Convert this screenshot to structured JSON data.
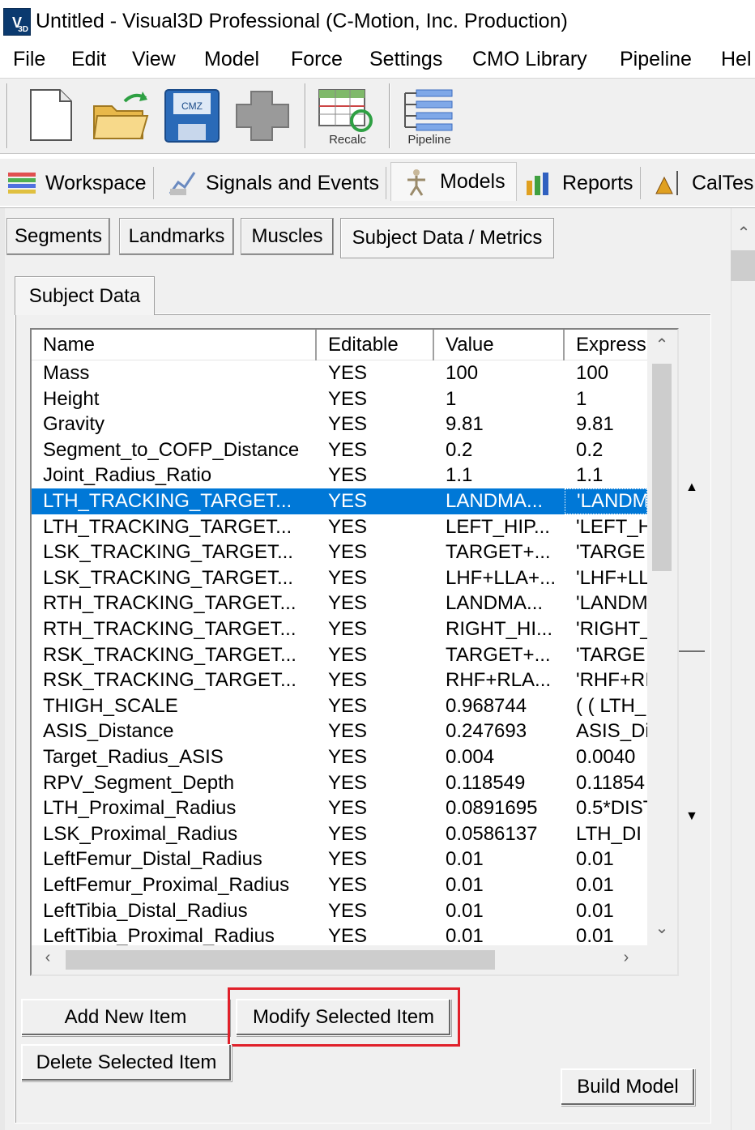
{
  "window": {
    "icon_text": "V",
    "icon_sub": "3D",
    "title": "Untitled - Visual3D Professional (C-Motion, Inc. Production)"
  },
  "menu": [
    "File",
    "Edit",
    "View",
    "Model",
    "Force",
    "Settings",
    "CMO Library",
    "Pipeline",
    "Hel"
  ],
  "toolbar": {
    "recalc_label": "Recalc",
    "pipeline_label": "Pipeline",
    "cmz_label": "CMZ"
  },
  "main_tabs": [
    "Workspace",
    "Signals and Events",
    "Models",
    "Reports",
    "CalTes"
  ],
  "active_main_tab": "Models",
  "sub_tabs": [
    "Segments",
    "Landmarks",
    "Muscles",
    "Subject Data / Metrics"
  ],
  "active_sub_tab": "Subject Data / Metrics",
  "inner_tab": "Subject Data",
  "table": {
    "columns": [
      "Name",
      "Editable",
      "Value",
      "Express"
    ],
    "selected_index": 5,
    "rows": [
      [
        "Mass",
        "YES",
        "100",
        "100"
      ],
      [
        "Height",
        "YES",
        "1",
        "1"
      ],
      [
        "Gravity",
        "YES",
        "9.81",
        "9.81"
      ],
      [
        "Segment_to_COFP_Distance",
        "YES",
        "0.2",
        "0.2"
      ],
      [
        "Joint_Radius_Ratio",
        "YES",
        "1.1",
        "1.1"
      ],
      [
        "LTH_TRACKING_TARGET...",
        "YES",
        "LANDMA...",
        "'LANDM"
      ],
      [
        "LTH_TRACKING_TARGET...",
        "YES",
        "LEFT_HIP...",
        "'LEFT_H"
      ],
      [
        "LSK_TRACKING_TARGET...",
        "YES",
        "TARGET+...",
        "'TARGE"
      ],
      [
        "LSK_TRACKING_TARGET...",
        "YES",
        "LHF+LLA+...",
        "'LHF+LL"
      ],
      [
        "RTH_TRACKING_TARGET...",
        "YES",
        "LANDMA...",
        "'LANDM"
      ],
      [
        "RTH_TRACKING_TARGET...",
        "YES",
        "RIGHT_HI...",
        "'RIGHT_"
      ],
      [
        "RSK_TRACKING_TARGET...",
        "YES",
        "TARGET+...",
        "'TARGE"
      ],
      [
        "RSK_TRACKING_TARGET...",
        "YES",
        "RHF+RLA...",
        "'RHF+RI"
      ],
      [
        "THIGH_SCALE",
        "YES",
        "0.968744",
        "( ( LTH_"
      ],
      [
        "ASIS_Distance",
        "YES",
        "0.247693",
        "ASIS_Di"
      ],
      [
        "Target_Radius_ASIS",
        "YES",
        "0.004",
        "0.0040"
      ],
      [
        "RPV_Segment_Depth",
        "YES",
        "0.118549",
        "0.11854"
      ],
      [
        "LTH_Proximal_Radius",
        "YES",
        "0.0891695",
        "0.5*DIST"
      ],
      [
        "LSK_Proximal_Radius",
        "YES",
        "0.0586137",
        "LTH_DI"
      ],
      [
        "LeftFemur_Distal_Radius",
        "YES",
        "0.01",
        "0.01"
      ],
      [
        "LeftFemur_Proximal_Radius",
        "YES",
        "0.01",
        "0.01"
      ],
      [
        "LeftTibia_Distal_Radius",
        "YES",
        "0.01",
        "0.01"
      ],
      [
        "LeftTibia_Proximal_Radius",
        "YES",
        "0.01",
        "0.01"
      ]
    ]
  },
  "buttons": {
    "add": "Add New Item",
    "modify": "Modify Selected Item",
    "delete": "Delete Selected Item",
    "build": "Build Model"
  },
  "colors": {
    "selection": "#0078d7",
    "highlight_box": "#e0202a"
  }
}
